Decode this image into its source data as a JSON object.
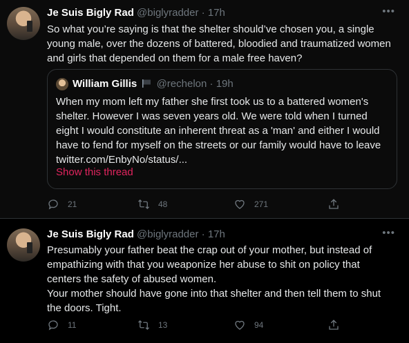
{
  "tweets": [
    {
      "author_name": "Je Suis Bigly Rad",
      "author_handle": "@biglyradder",
      "separator": "·",
      "time": "17h",
      "lines": [
        "So what you’re saying is that the shelter should’ve chosen you, a single",
        "young male, over the dozens of battered, bloodied and traumatized women",
        "and girls that depended on them for a male free haven?"
      ],
      "quote": {
        "author_name": "William Gillis",
        "author_handle": "@rechelon",
        "separator": "·",
        "time": "19h",
        "lines": [
          "When my mom left my father she first took us to a battered women's",
          "shelter. However I was seven years old. We were told when I turned",
          "eight I would constitute an inherent threat as a 'man' and either I would",
          "have to fend for myself on the streets or our family would have to leave",
          "twitter.com/EnbyNo/status/..."
        ],
        "show_thread": "Show this thread"
      },
      "stats": {
        "replies": "21",
        "retweets": "48",
        "likes": "271"
      }
    },
    {
      "author_name": "Je Suis Bigly Rad",
      "author_handle": "@biglyradder",
      "separator": "·",
      "time": "17h",
      "lines": [
        "Presumably your father beat the crap out of your mother, but instead of",
        "empathizing with that you weaponize her abuse to shit on policy that",
        "centers the safety of abused women.",
        "Your mother should have gone into that shelter and then tell them to shut",
        "the doors. Tight."
      ],
      "stats": {
        "replies": "11",
        "retweets": "13",
        "likes": "94"
      }
    }
  ],
  "icons": {
    "more": "more-dots-icon",
    "reply": "reply-bubble-icon",
    "retweet": "retweet-arrows-icon",
    "like": "heart-icon",
    "share": "share-upload-icon",
    "flag": "black-flag-icon"
  },
  "colors": {
    "background": "#000000",
    "text": "#e7e9ea",
    "secondary": "#6e767d",
    "link": "#e0245e",
    "border": "#2f3336"
  }
}
